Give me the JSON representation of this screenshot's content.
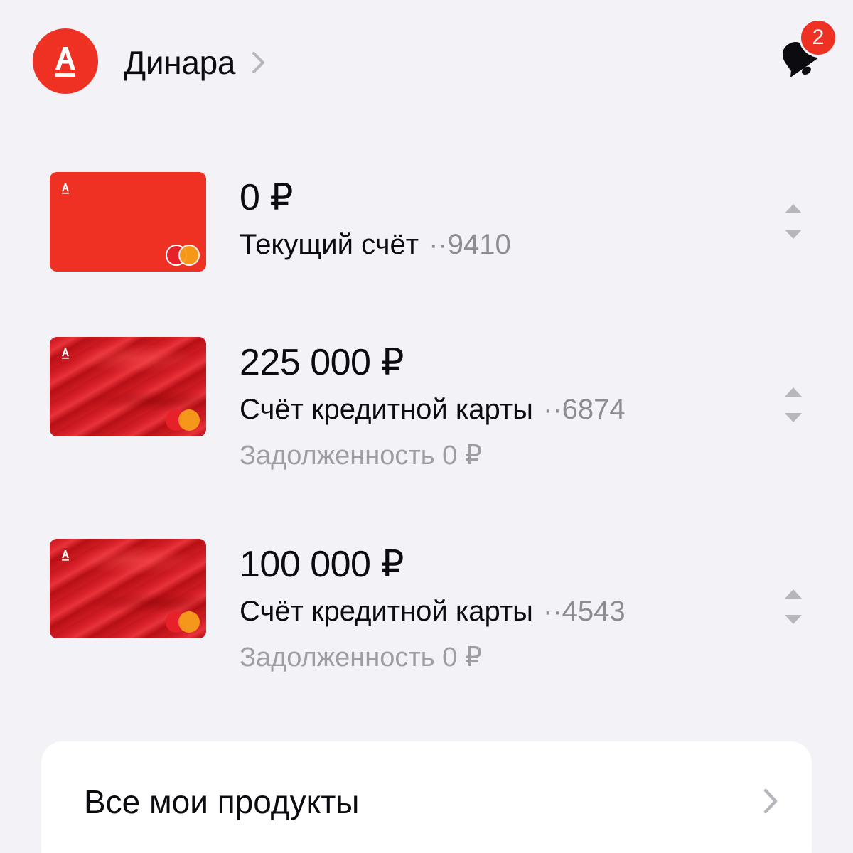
{
  "header": {
    "user_name": "Динара",
    "notifications_count": "2",
    "colors": {
      "brand": "#EF3124"
    },
    "icons": {
      "logo": "alfa-logo-icon",
      "chevron": "chevron-right-icon",
      "bell": "bell-icon"
    }
  },
  "accounts": [
    {
      "amount": "0 ₽",
      "title": "Текущий счёт",
      "mask": "··9410",
      "card_style": "plain-red",
      "payment_system": "mastercard-icon"
    },
    {
      "amount": "225 000 ₽",
      "title": "Счёт кредитной карты",
      "mask": "··6874",
      "debt": "Задолженность 0 ₽",
      "card_style": "red-pattern",
      "payment_system": "mastercard-icon"
    },
    {
      "amount": "100 000 ₽",
      "title": "Счёт кредитной карты",
      "mask": "··4543",
      "debt": "Задолженность 0 ₽",
      "card_style": "red-pattern",
      "payment_system": "mastercard-icon"
    }
  ],
  "all_products": {
    "label": "Все мои продукты"
  }
}
